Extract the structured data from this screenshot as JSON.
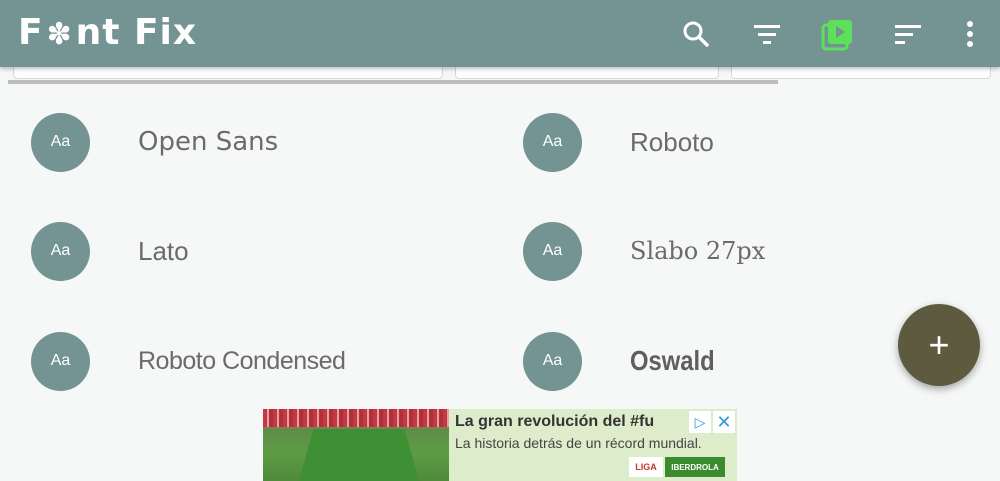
{
  "appbar": {
    "title_pre": "F",
    "title_post": "nt Fix",
    "actions": [
      {
        "icon": "search-icon"
      },
      {
        "icon": "filter-icon"
      },
      {
        "icon": "preview-icon",
        "color": "#5ee05a"
      },
      {
        "icon": "sort-icon"
      },
      {
        "icon": "more-vert-icon"
      }
    ],
    "color": "#739493"
  },
  "fonts": [
    {
      "avatar": "Aa",
      "name": "Open Sans"
    },
    {
      "avatar": "Aa",
      "name": "Roboto"
    },
    {
      "avatar": "Aa",
      "name": "Lato"
    },
    {
      "avatar": "Aa",
      "name": "Slabo 27px"
    },
    {
      "avatar": "Aa",
      "name": "Roboto Condensed"
    },
    {
      "avatar": "Aa",
      "name": "Oswald"
    }
  ],
  "fab": {
    "label": "+",
    "color": "#5d5a40"
  },
  "ad": {
    "headline": "La gran revolución del #fu",
    "subtext": "La historia detrás de un récord mundial.",
    "adchoices": "▷",
    "close": "✕",
    "logo1": "LIGA",
    "logo2": "IBERDROLA"
  }
}
